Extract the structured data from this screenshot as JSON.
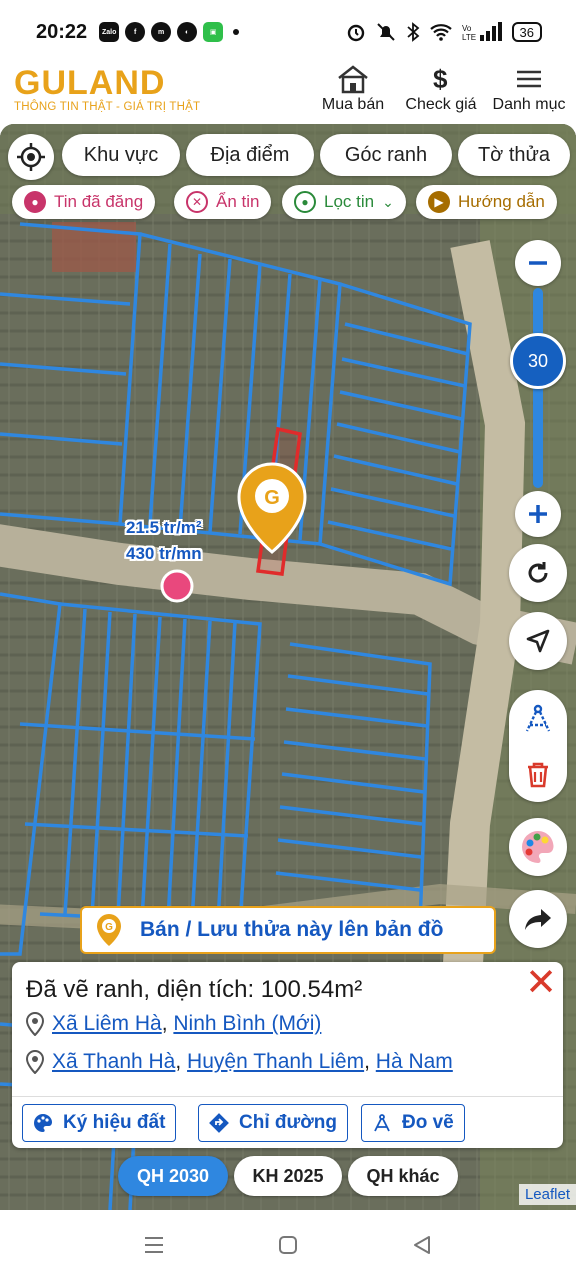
{
  "status": {
    "time": "20:22",
    "battery": "36",
    "apps": [
      "Zalo",
      "f",
      "m",
      "◐",
      "▣"
    ]
  },
  "header": {
    "logo": "GULAND",
    "tagline": "THÔNG TIN THẬT - GIÁ TRỊ THẬT",
    "nav": [
      {
        "label": "Mua bán",
        "icon": "house-icon"
      },
      {
        "label": "Check giá",
        "icon": "dollar-icon"
      },
      {
        "label": "Danh mục",
        "icon": "menu-icon"
      }
    ]
  },
  "filters": {
    "region": "Khu vực",
    "place": "Địa điểm",
    "corner": "Góc ranh",
    "sheet": "Tờ thửa"
  },
  "pills": {
    "posted": "Tin đã đăng",
    "hide": "Ẩn tin",
    "filter": "Lọc tin",
    "guide": "Hướng dẫn"
  },
  "zoom": {
    "level": "30"
  },
  "price": {
    "per_m2": "21.5 tr/m²",
    "per_front": "430 tr/mn"
  },
  "sell_banner": "Bán / Lưu thửa này lên bản đồ",
  "card": {
    "title": "Đã vẽ ranh, diện tích: 100.54m²",
    "address_new": {
      "commune": "Xã Liêm Hà",
      "province": "Ninh Bình (Mới)"
    },
    "address_old": {
      "commune": "Xã Thanh Hà",
      "district": "Huyện Thanh Liêm",
      "province": "Hà Nam"
    },
    "buttons": {
      "land_symbol": "Ký hiệu đất",
      "directions": "Chỉ đường",
      "measure": "Đo vẽ"
    }
  },
  "plan_tabs": [
    "QH 2030",
    "KH 2025",
    "QH khác"
  ],
  "attribution": "Leaflet",
  "colors": {
    "brand": "#e8a21a",
    "accent": "#1558c0",
    "parcel": "#2f87e0",
    "highlight": "#e02b2b",
    "close": "#d93a2b"
  }
}
